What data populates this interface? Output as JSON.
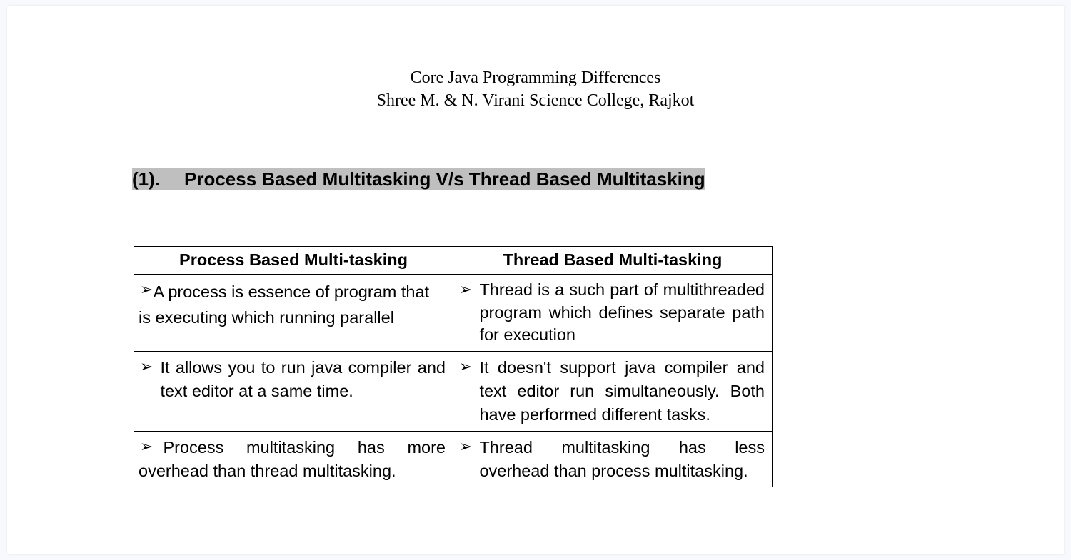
{
  "header": {
    "title_line1": "Core Java Programming Differences",
    "title_line2": "Shree M. & N. Virani Science College, Rajkot"
  },
  "section": {
    "number": "(1).",
    "title": "Process Based Multitasking V/s Thread Based Multitasking"
  },
  "table": {
    "headers": {
      "left": "Process Based Multi-tasking",
      "right": "Thread Based Multi-tasking"
    },
    "bullet": "➢",
    "rows": [
      {
        "left": "A process is essence of program that is executing which running parallel",
        "right": "Thread is a such part of multithreaded program which defines separate path for execution"
      },
      {
        "left": "It allows you to run java compiler and text editor at a same time.",
        "right": "It doesn't support java compiler and text editor run simultaneously. Both have performed different tasks."
      },
      {
        "left": "Process multitasking has more overhead than thread multitasking.",
        "right": "Thread multitasking has less overhead than process multitasking."
      }
    ]
  }
}
